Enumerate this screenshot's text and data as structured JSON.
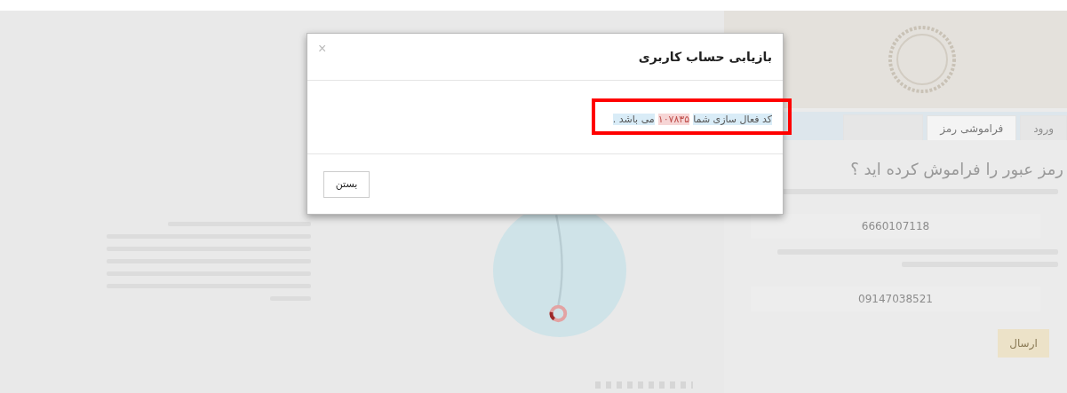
{
  "dialog": {
    "title": "بازیابی حساب کاربری",
    "close": "×",
    "message": {
      "before": "کد فعال سازی شما",
      "code": "۱۰۷۸۳۵",
      "after": "می باشد ."
    },
    "close_button": "بستن"
  },
  "login_panel": {
    "tabs": [
      {
        "label": "ورود",
        "selected": false
      },
      {
        "label": "فراموشی رمز",
        "selected": true
      }
    ],
    "heading": "رمز عبور را فراموش کرده اید ؟",
    "fields": [
      {
        "value": "6660107118"
      },
      {
        "value": "09147038521"
      }
    ],
    "submit": "ارسال"
  }
}
